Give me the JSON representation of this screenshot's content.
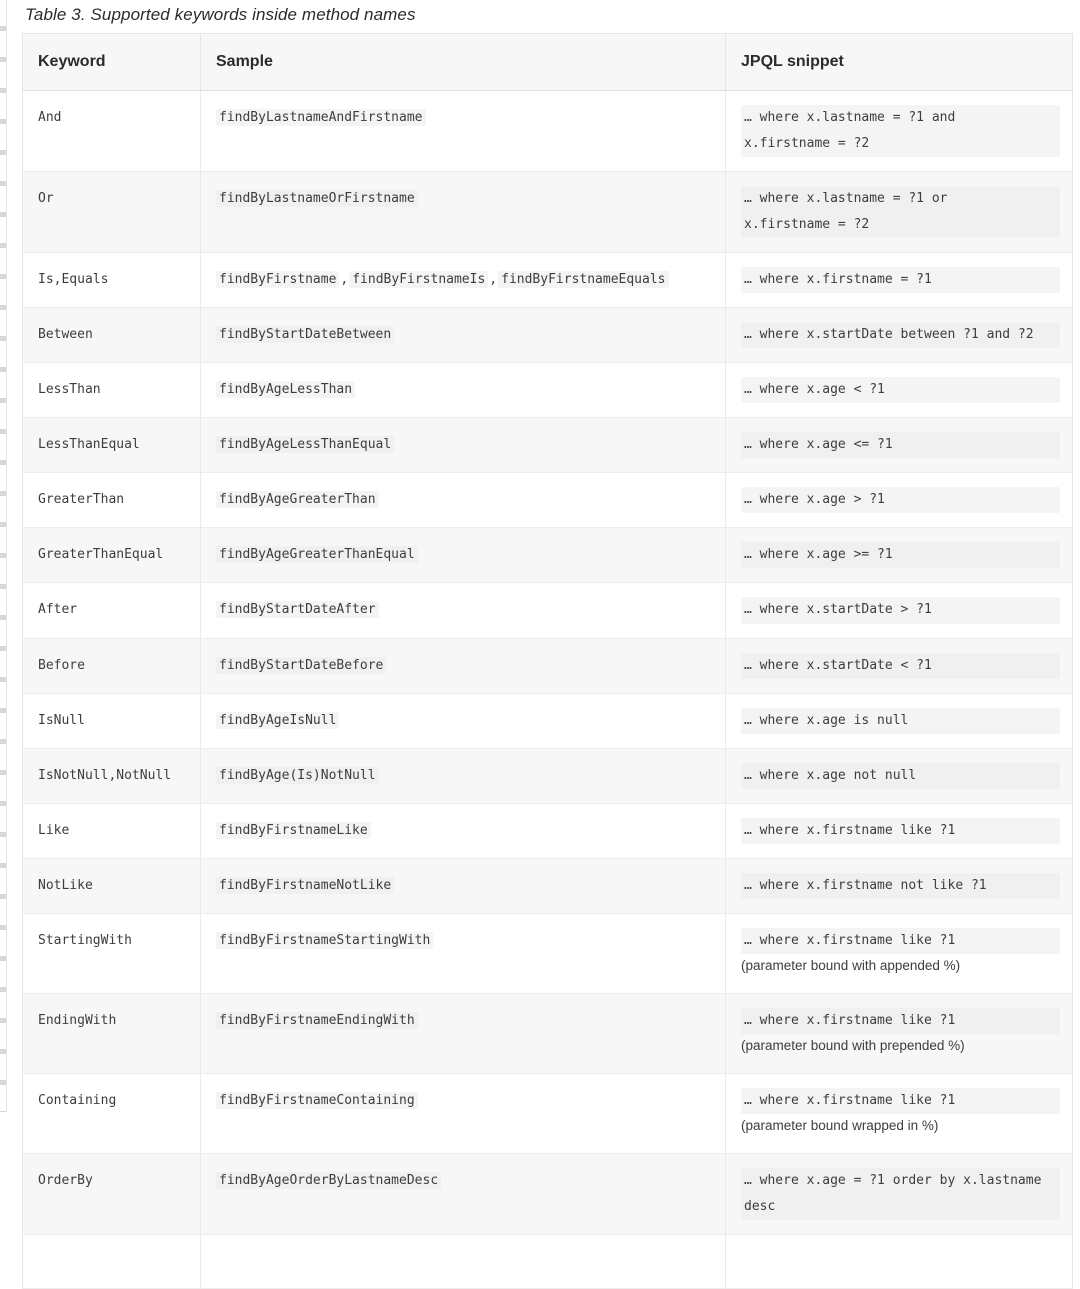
{
  "caption": "Table 3. Supported keywords inside method names",
  "table": {
    "columns": [
      "Keyword",
      "Sample",
      "JPQL snippet"
    ],
    "rows": [
      {
        "keyword": "And",
        "sample": "findByLastnameAndFirstname",
        "snippet_lines": [
          "… where x.lastname = ?1 and",
          "x.firstname = ?2"
        ]
      },
      {
        "keyword": "Or",
        "sample": "findByLastnameOrFirstname",
        "snippet_lines": [
          "… where x.lastname = ?1 or",
          "x.firstname = ?2"
        ]
      },
      {
        "keyword": "Is,Equals",
        "sample_parts": [
          "findByFirstname",
          "findByFirstnameIs",
          "findByFirstnameEquals"
        ],
        "snippet_lines": [
          "… where x.firstname = ?1"
        ]
      },
      {
        "keyword": "Between",
        "sample": "findByStartDateBetween",
        "snippet_lines": [
          "… where x.startDate between ?1 and ?2"
        ]
      },
      {
        "keyword": "LessThan",
        "sample": "findByAgeLessThan",
        "snippet_lines": [
          "… where x.age < ?1"
        ]
      },
      {
        "keyword": "LessThanEqual",
        "sample": "findByAgeLessThanEqual",
        "snippet_lines": [
          "… where x.age <= ?1"
        ]
      },
      {
        "keyword": "GreaterThan",
        "sample": "findByAgeGreaterThan",
        "snippet_lines": [
          "… where x.age > ?1"
        ]
      },
      {
        "keyword": "GreaterThanEqual",
        "sample": "findByAgeGreaterThanEqual",
        "snippet_lines": [
          "… where x.age >= ?1"
        ]
      },
      {
        "keyword": "After",
        "sample": "findByStartDateAfter",
        "snippet_lines": [
          "… where x.startDate > ?1"
        ]
      },
      {
        "keyword": "Before",
        "sample": "findByStartDateBefore",
        "snippet_lines": [
          "… where x.startDate < ?1"
        ]
      },
      {
        "keyword": "IsNull",
        "sample": "findByAgeIsNull",
        "snippet_lines": [
          "… where x.age is null"
        ]
      },
      {
        "keyword": "IsNotNull,NotNull",
        "sample": "findByAge(Is)NotNull",
        "snippet_lines": [
          "… where x.age not null"
        ]
      },
      {
        "keyword": "Like",
        "sample": "findByFirstnameLike",
        "snippet_lines": [
          "… where x.firstname like ?1"
        ]
      },
      {
        "keyword": "NotLike",
        "sample": "findByFirstnameNotLike",
        "snippet_lines": [
          "… where x.firstname not like ?1"
        ]
      },
      {
        "keyword": "StartingWith",
        "sample": "findByFirstnameStartingWith",
        "snippet_lines": [
          "… where x.firstname like ?1"
        ],
        "note": "(parameter bound with appended %)"
      },
      {
        "keyword": "EndingWith",
        "sample": "findByFirstnameEndingWith",
        "snippet_lines": [
          "… where x.firstname like ?1"
        ],
        "note": "(parameter bound with prepended %)"
      },
      {
        "keyword": "Containing",
        "sample": "findByFirstnameContaining",
        "snippet_lines": [
          "… where x.firstname like ?1"
        ],
        "note": "(parameter bound wrapped in %)"
      },
      {
        "keyword": "OrderBy",
        "sample": "findByAgeOrderByLastnameDesc",
        "snippet_lines": [
          "… where x.age = ?1 order by x.lastname",
          "desc"
        ]
      }
    ]
  },
  "colors": {
    "header_background": "#f7f7f7",
    "row_alt_background": "#f7f7f7",
    "border": "#e6e6e6",
    "text": "#3d3d3d",
    "code_background": "#f4f4f4"
  }
}
